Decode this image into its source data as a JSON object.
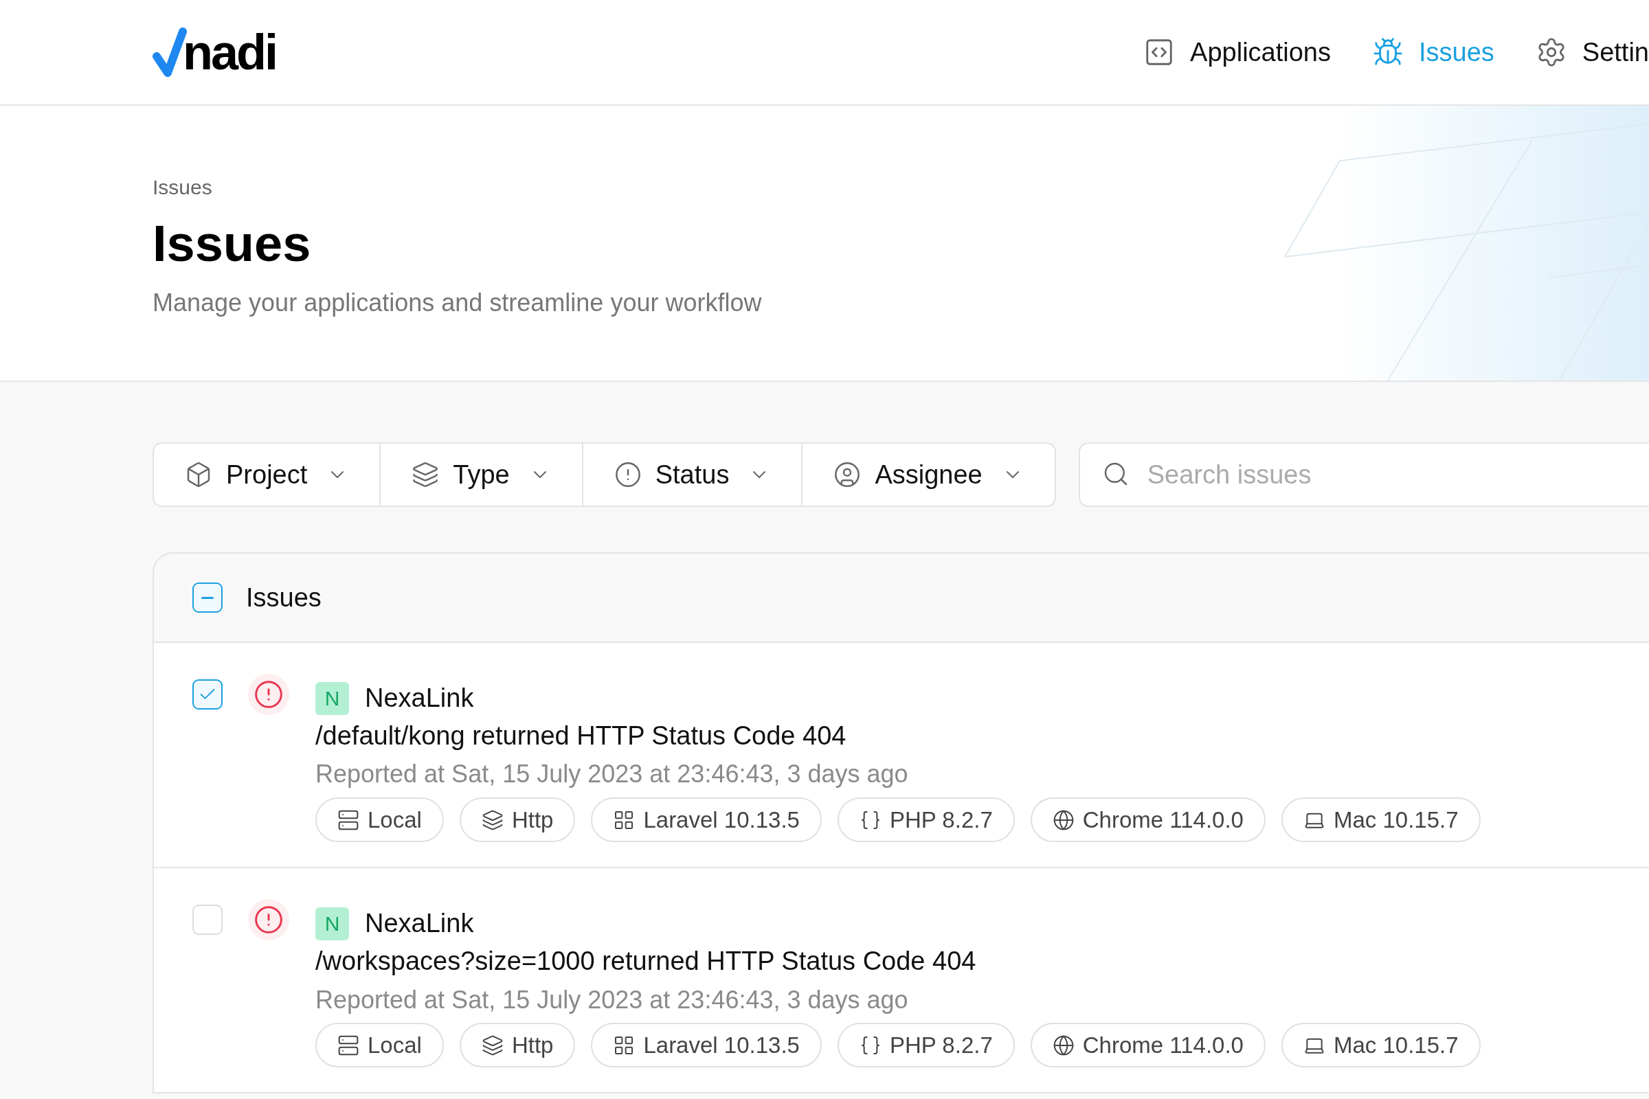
{
  "logo": {
    "text": "nadi"
  },
  "nav": [
    {
      "label": "Applications",
      "selected": false
    },
    {
      "label": "Issues",
      "selected": true
    },
    {
      "label": "Settin",
      "selected": false
    }
  ],
  "breadcrumb": "Issues",
  "title": "Issues",
  "subtitle": "Manage your applications and streamline your workflow",
  "filters": [
    {
      "label": "Project"
    },
    {
      "label": "Type"
    },
    {
      "label": "Status"
    },
    {
      "label": "Assignee"
    }
  ],
  "search": {
    "placeholder": "Search issues"
  },
  "list": {
    "title": "Issues",
    "select_all_indeterminate": true,
    "issues": [
      {
        "checked": true,
        "project_initial": "N",
        "project": "NexaLink",
        "message": "/default/kong returned HTTP Status Code 404",
        "reported": "Reported at Sat, 15 July 2023 at 23:46:43, 3 days ago",
        "tags": [
          {
            "kind": "server",
            "label": "Local"
          },
          {
            "kind": "layers",
            "label": "Http"
          },
          {
            "kind": "grid",
            "label": "Laravel 10.13.5"
          },
          {
            "kind": "braces",
            "label": "PHP 8.2.7"
          },
          {
            "kind": "globe",
            "label": "Chrome 114.0.0"
          },
          {
            "kind": "laptop",
            "label": "Mac 10.15.7"
          }
        ]
      },
      {
        "checked": false,
        "project_initial": "N",
        "project": "NexaLink",
        "message": "/workspaces?size=1000 returned HTTP Status Code 404",
        "reported": "Reported at Sat, 15 July 2023 at 23:46:43, 3 days ago",
        "tags": [
          {
            "kind": "server",
            "label": "Local"
          },
          {
            "kind": "layers",
            "label": "Http"
          },
          {
            "kind": "grid",
            "label": "Laravel 10.13.5"
          },
          {
            "kind": "braces",
            "label": "PHP 8.2.7"
          },
          {
            "kind": "globe",
            "label": "Chrome 114.0.0"
          },
          {
            "kind": "laptop",
            "label": "Mac 10.15.7"
          }
        ]
      }
    ]
  }
}
